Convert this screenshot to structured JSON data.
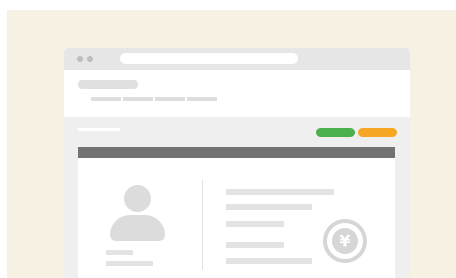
{
  "browser": {
    "traffic_lights": [
      "dot",
      "dot"
    ],
    "address_bar": ""
  },
  "site_header": {
    "logo_placeholder": "",
    "nav_items": [
      "",
      "",
      "",
      ""
    ]
  },
  "toolbar": {
    "breadcrumb": "",
    "primary_button_color": "#4caf50",
    "secondary_button_color": "#f5a623"
  },
  "profile_card": {
    "header_color": "#737373",
    "avatar_icon": "user-silhouette-icon",
    "currency_icon": "yen-icon",
    "currency_symbol": "¥"
  }
}
